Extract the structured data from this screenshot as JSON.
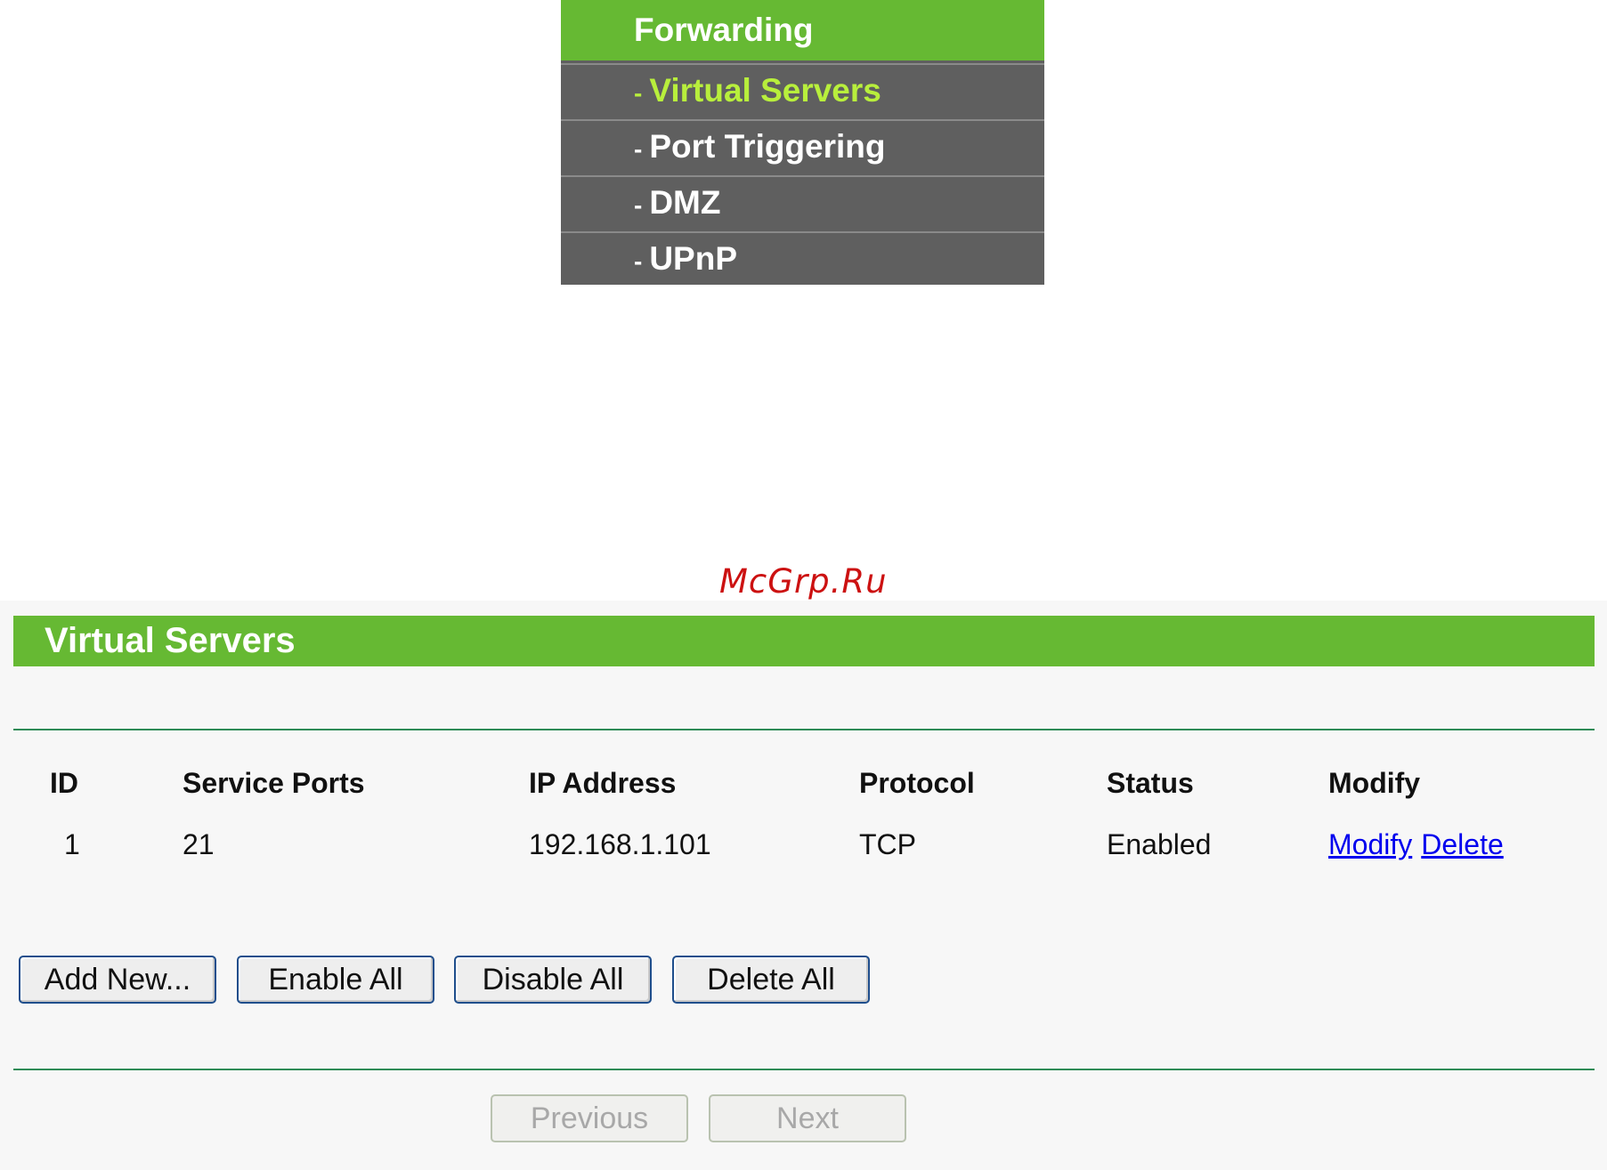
{
  "menu": {
    "title": "Forwarding",
    "items": [
      {
        "dash": "-",
        "label": "Virtual Servers",
        "active": true
      },
      {
        "dash": "-",
        "label": "Port Triggering",
        "active": false
      },
      {
        "dash": "-",
        "label": "DMZ",
        "active": false
      },
      {
        "dash": "-",
        "label": "UPnP",
        "active": false
      }
    ]
  },
  "watermark": "McGrp.Ru",
  "panel": {
    "title": "Virtual Servers",
    "table": {
      "headers": [
        "ID",
        "Service Ports",
        "IP Address",
        "Protocol",
        "Status",
        "Modify"
      ],
      "rows": [
        {
          "id": "1",
          "ports": "21",
          "ip": "192.168.1.101",
          "protocol": "TCP",
          "status": "Enabled",
          "modify_link": "Modify",
          "delete_link": "Delete"
        }
      ]
    },
    "buttons": {
      "add_new": "Add New...",
      "enable_all": "Enable All",
      "disable_all": "Disable All",
      "delete_all": "Delete All"
    },
    "pagination": {
      "previous": "Previous",
      "next": "Next"
    }
  },
  "colors": {
    "accent_green": "#66b933",
    "active_item": "#b8ef3c",
    "menu_bg": "#5f5f5f",
    "rule": "#2e8b57",
    "link": "#0000ee"
  }
}
